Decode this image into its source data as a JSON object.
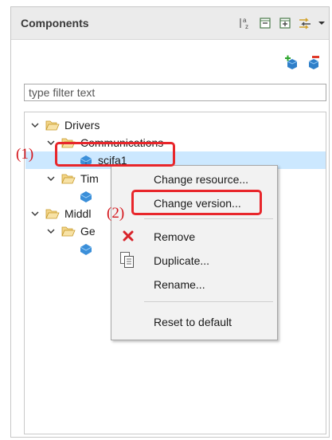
{
  "panel": {
    "title": "Components"
  },
  "filter": {
    "placeholder": "type filter text",
    "value": ""
  },
  "tree": {
    "drivers": "Drivers",
    "communications": "Communications",
    "scifa1": "scifa1",
    "timers_partial": "Tim",
    "middleware_partial": "Middl",
    "generic_partial": "Ge"
  },
  "context_menu": {
    "change_resource": "Change resource...",
    "change_version": "Change version...",
    "remove": "Remove",
    "duplicate": "Duplicate...",
    "rename": "Rename...",
    "reset": "Reset to default"
  },
  "callouts": {
    "one": "(1)",
    "two": "(2)"
  },
  "colors": {
    "selection": "#cce8ff",
    "highlight": "#e8262b",
    "callout_text": "#d4151b",
    "folder": "#f0c75e",
    "component_icon": "#3b8fd9"
  }
}
